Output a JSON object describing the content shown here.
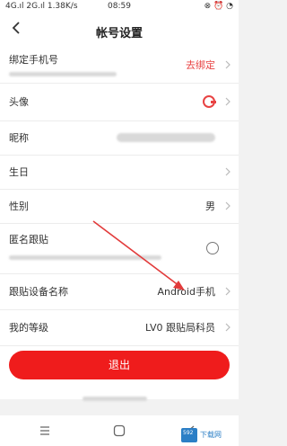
{
  "status_bar": {
    "network": "4G.ıl 2G.ıl 1.38K/s",
    "time": "08:59",
    "icons": "⊗ ⏰ ◔"
  },
  "header": {
    "title": "帐号设置",
    "back_icon": "chevron-left-icon"
  },
  "rows": {
    "phone": {
      "label": "绑定手机号",
      "value": "去绑定"
    },
    "avatar": {
      "label": "头像"
    },
    "nickname": {
      "label": "昵称"
    },
    "birthday": {
      "label": "生日"
    },
    "gender": {
      "label": "性别",
      "value": "男"
    },
    "anonymous": {
      "label": "匿名跟贴"
    },
    "device": {
      "label": "跟贴设备名称",
      "value": "Android手机"
    },
    "level": {
      "label": "我的等级",
      "value": "LV0 跟贴局科员"
    }
  },
  "logout": {
    "label": "退出"
  },
  "colors": {
    "accent": "#ef1c1c",
    "annotation_arrow": "#e23b3b"
  },
  "watermark": {
    "badge": "592",
    "text": "下载网"
  }
}
